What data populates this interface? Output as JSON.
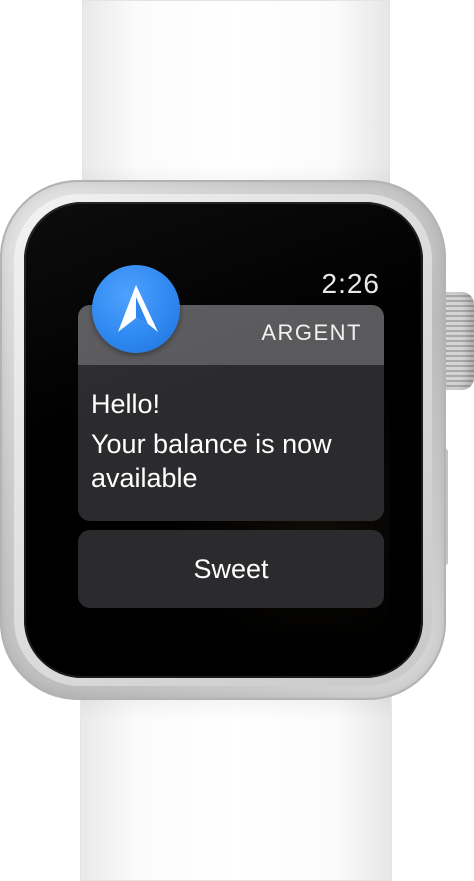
{
  "status": {
    "time": "2:26"
  },
  "notification": {
    "app_name": "ARGENT",
    "app_icon": "argent-logo-icon",
    "title": "Hello!",
    "message": "Your balance is now available"
  },
  "actions": {
    "primary_label": "Sweet"
  },
  "colors": {
    "icon_blue": "#2b86f0",
    "header_gray": "#5a5a5c",
    "card_dark": "#2b2b2d",
    "screen_black": "#000000"
  }
}
